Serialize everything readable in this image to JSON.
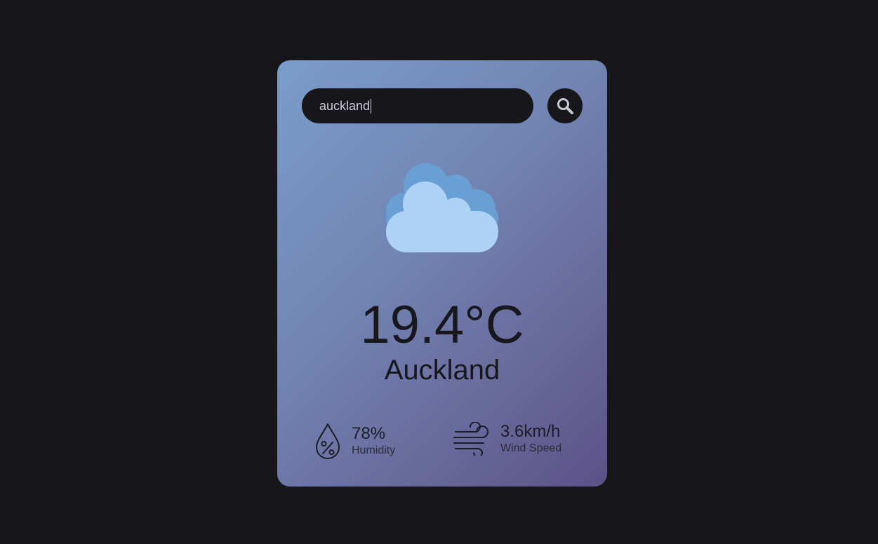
{
  "search": {
    "value": "auckland",
    "icon": "search-icon"
  },
  "weather": {
    "icon": "cloud-icon",
    "temperature": "19.4°C",
    "city": "Auckland"
  },
  "stats": {
    "humidity": {
      "value": "78%",
      "label": "Humidity",
      "icon": "humidity-icon"
    },
    "wind": {
      "value": "3.6km/h",
      "label": "Wind Speed",
      "icon": "wind-icon"
    }
  },
  "colors": {
    "page_background": "#16161b",
    "card_gradient_start": "#7b9ccb",
    "card_gradient_end": "#5c5188",
    "cloud_back": "#6a9fd4",
    "cloud_front": "#aed2f5",
    "text_dark": "#17171d"
  }
}
